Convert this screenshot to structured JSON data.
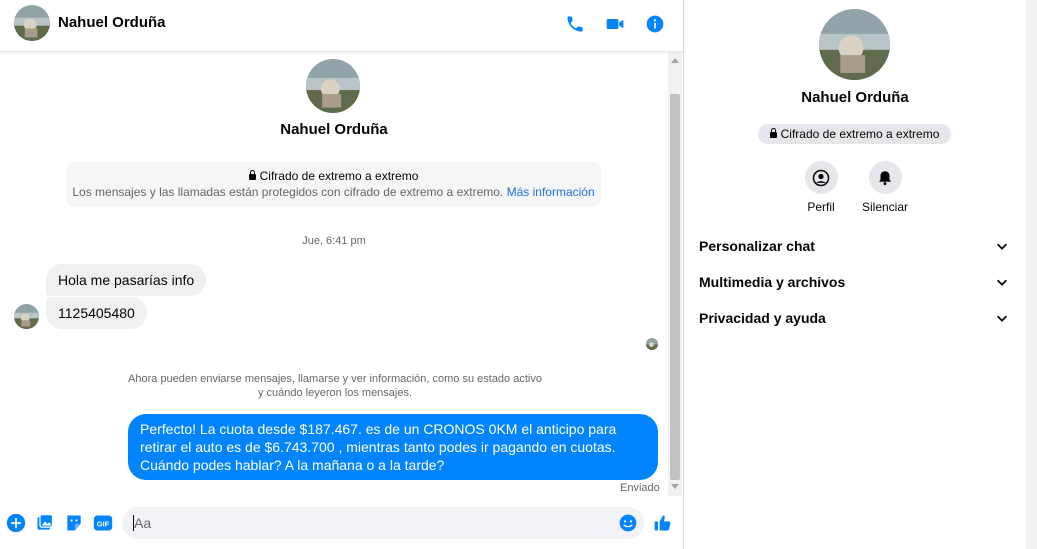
{
  "header": {
    "contact_name": "Nahuel Orduña",
    "icons": [
      "phone-icon",
      "video-camera-icon",
      "info-icon"
    ],
    "accent_color": "#0084ff"
  },
  "conversation": {
    "contact_name": "Nahuel Orduña",
    "encryption": {
      "title": "Cifrado de extremo a extremo",
      "description": "Los mensajes y las llamadas están protegidos con cifrado de extremo a extremo.",
      "link": "Más información"
    },
    "timestamp": "Jue, 6:41 pm",
    "incoming": [
      {
        "text": "Hola me pasarías info"
      },
      {
        "text": "1125405480"
      }
    ],
    "status_note_line1": "Ahora pueden enviarse mensajes, llamarse y ver información, como su estado activo",
    "status_note_line2": "y cuándo leyeron los mensajes.",
    "outgoing": {
      "text": "Perfecto! La cuota desde $187.467. es de un CRONOS 0KM el anticipo para retirar el auto es de $6.743.700 , mientras tanto podes ir pagando en cuotas. Cuándo podes hablar? A la mañana o a la tarde?",
      "status": "Enviado",
      "bubble_color": "#0084ff"
    }
  },
  "composer": {
    "placeholder": "Aa",
    "icons": [
      "add-icon",
      "photo-icon",
      "sticker-icon",
      "gif-icon",
      "emoji-icon",
      "like-icon"
    ],
    "gif_label": "GIF"
  },
  "info_panel": {
    "contact_name": "Nahuel Orduña",
    "encryption_pill": "Cifrado de extremo a extremo",
    "actions": [
      {
        "label": "Perfil",
        "icon": "profile-icon"
      },
      {
        "label": "Silenciar",
        "icon": "bell-icon"
      }
    ],
    "sections": [
      {
        "label": "Personalizar chat"
      },
      {
        "label": "Multimedia y archivos"
      },
      {
        "label": "Privacidad y ayuda"
      }
    ]
  }
}
